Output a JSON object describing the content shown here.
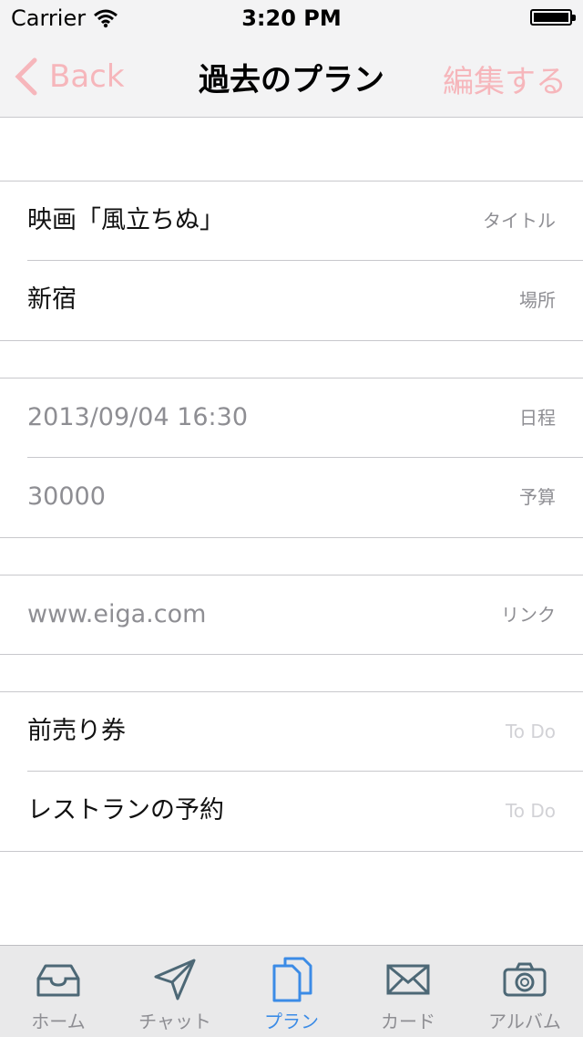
{
  "status": {
    "carrier": "Carrier",
    "time": "3:20 PM"
  },
  "nav": {
    "back_label": "Back",
    "title": "過去のプラン",
    "edit_label": "編集する"
  },
  "sections": {
    "basic": [
      {
        "value": "映画「風立ちぬ」",
        "tag": "タイトル"
      },
      {
        "value": "新宿",
        "tag": "場所"
      }
    ],
    "schedule": [
      {
        "value": "2013/09/04 16:30",
        "tag": "日程"
      },
      {
        "value": "30000",
        "tag": "予算"
      }
    ],
    "link": [
      {
        "value": "www.eiga.com",
        "tag": "リンク"
      }
    ],
    "todo": [
      {
        "value": "前売り券",
        "tag": "To Do"
      },
      {
        "value": "レストランの予約",
        "tag": "To Do"
      }
    ]
  },
  "tabbar": [
    {
      "label": "ホーム",
      "icon": "inbox-icon"
    },
    {
      "label": "チャット",
      "icon": "send-icon"
    },
    {
      "label": "プラン",
      "icon": "documents-icon",
      "active": true
    },
    {
      "label": "カード",
      "icon": "envelope-icon"
    },
    {
      "label": "アルバム",
      "icon": "camera-icon"
    }
  ],
  "colors": {
    "accent_pink": "#f6b6bb",
    "tab_active": "#3b8be6",
    "separator": "#c8c8cc"
  }
}
